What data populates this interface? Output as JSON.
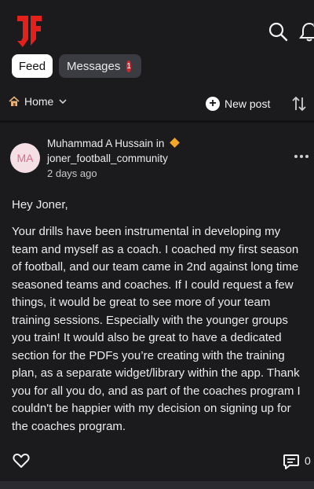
{
  "brand": {
    "logo_text": "JF",
    "accent_color": "#e3201b"
  },
  "tabs": {
    "feed_label": "Feed",
    "messages_label": "Messages",
    "messages_badge": "1"
  },
  "filter": {
    "home_label": "Home",
    "new_post_label": "New post"
  },
  "icons": {
    "search": "search-icon",
    "notifications": "bell-icon",
    "home": "house-icon",
    "dropdown": "chevron-down-icon",
    "new_post": "plus-icon",
    "sort": "sort-arrows-icon",
    "more": "more-dots-icon",
    "like": "heart-icon",
    "comment": "comment-icon"
  },
  "post": {
    "avatar_initials": "MA",
    "author_name": "Muhammad A Hussain",
    "in_label": "in",
    "community": "joner_football_community",
    "time_ago": "2 days ago",
    "greeting": "Hey Joner,",
    "body": "Your drills have been instrumental in developing my team and myself as a coach. I coached my first season of football, and our team came in 2nd against long time seasoned teams and coaches. If I could request a few things, it would be great to see more of your team training sessions. Especially with the younger groups you train! It would also be great to have a dedicated section for the PDFs you’re creating with the training plan, as a separate widget/library within the app. Thank you for all you do, and as part of the coaches program I couldn't be happier with my decision on signing up for the coaches program.",
    "comment_count": "0"
  }
}
